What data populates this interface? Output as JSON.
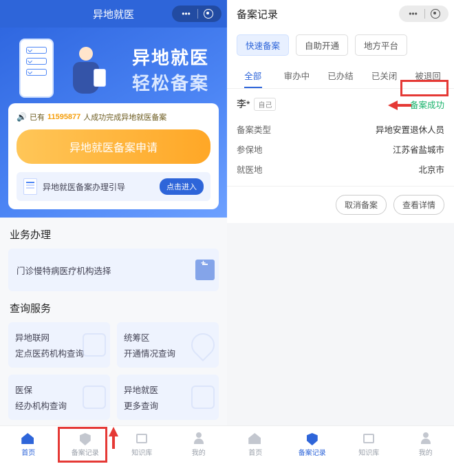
{
  "left": {
    "title": "异地就医",
    "hero": {
      "line1": "异地就医",
      "line2": "轻松备案"
    },
    "stat": {
      "prefix": "已有",
      "count": "11595877",
      "suffix": "人成功完成异地就医备案"
    },
    "apply_label": "异地就医备案申请",
    "guide": {
      "text": "异地就医备案办理引导",
      "btn": "点击进入"
    },
    "sec_business": "业务办理",
    "biz_card": "门诊慢特病医疗机构选择",
    "sec_query": "查询服务",
    "q": {
      "a1": "异地联网",
      "a2": "定点医药机构查询",
      "b1": "统筹区",
      "b2": "开通情况查询",
      "c1": "医保",
      "c2": "经办机构查询",
      "d1": "异地就医",
      "d2": "更多查询"
    },
    "tabs": {
      "home": "首页",
      "record": "备案记录",
      "kb": "知识库",
      "mine": "我的"
    }
  },
  "right": {
    "title": "备案记录",
    "chips": {
      "fast": "快速备案",
      "self": "自助开通",
      "local": "地方平台"
    },
    "tabs": {
      "all": "全部",
      "processing": "审办中",
      "done": "已办结",
      "closed": "已关闭",
      "returned": "被退回"
    },
    "record": {
      "name": "李*",
      "self_tag": "自己",
      "status": "备案成功",
      "rows": [
        {
          "k": "备案类型",
          "v": "异地安置退休人员"
        },
        {
          "k": "参保地",
          "v": "江苏省盐城市"
        },
        {
          "k": "就医地",
          "v": "北京市"
        }
      ],
      "actions": {
        "cancel": "取消备案",
        "detail": "查看详情"
      }
    },
    "tabs_bottom": {
      "home": "首页",
      "record": "备案记录",
      "kb": "知识库",
      "mine": "我的"
    }
  }
}
